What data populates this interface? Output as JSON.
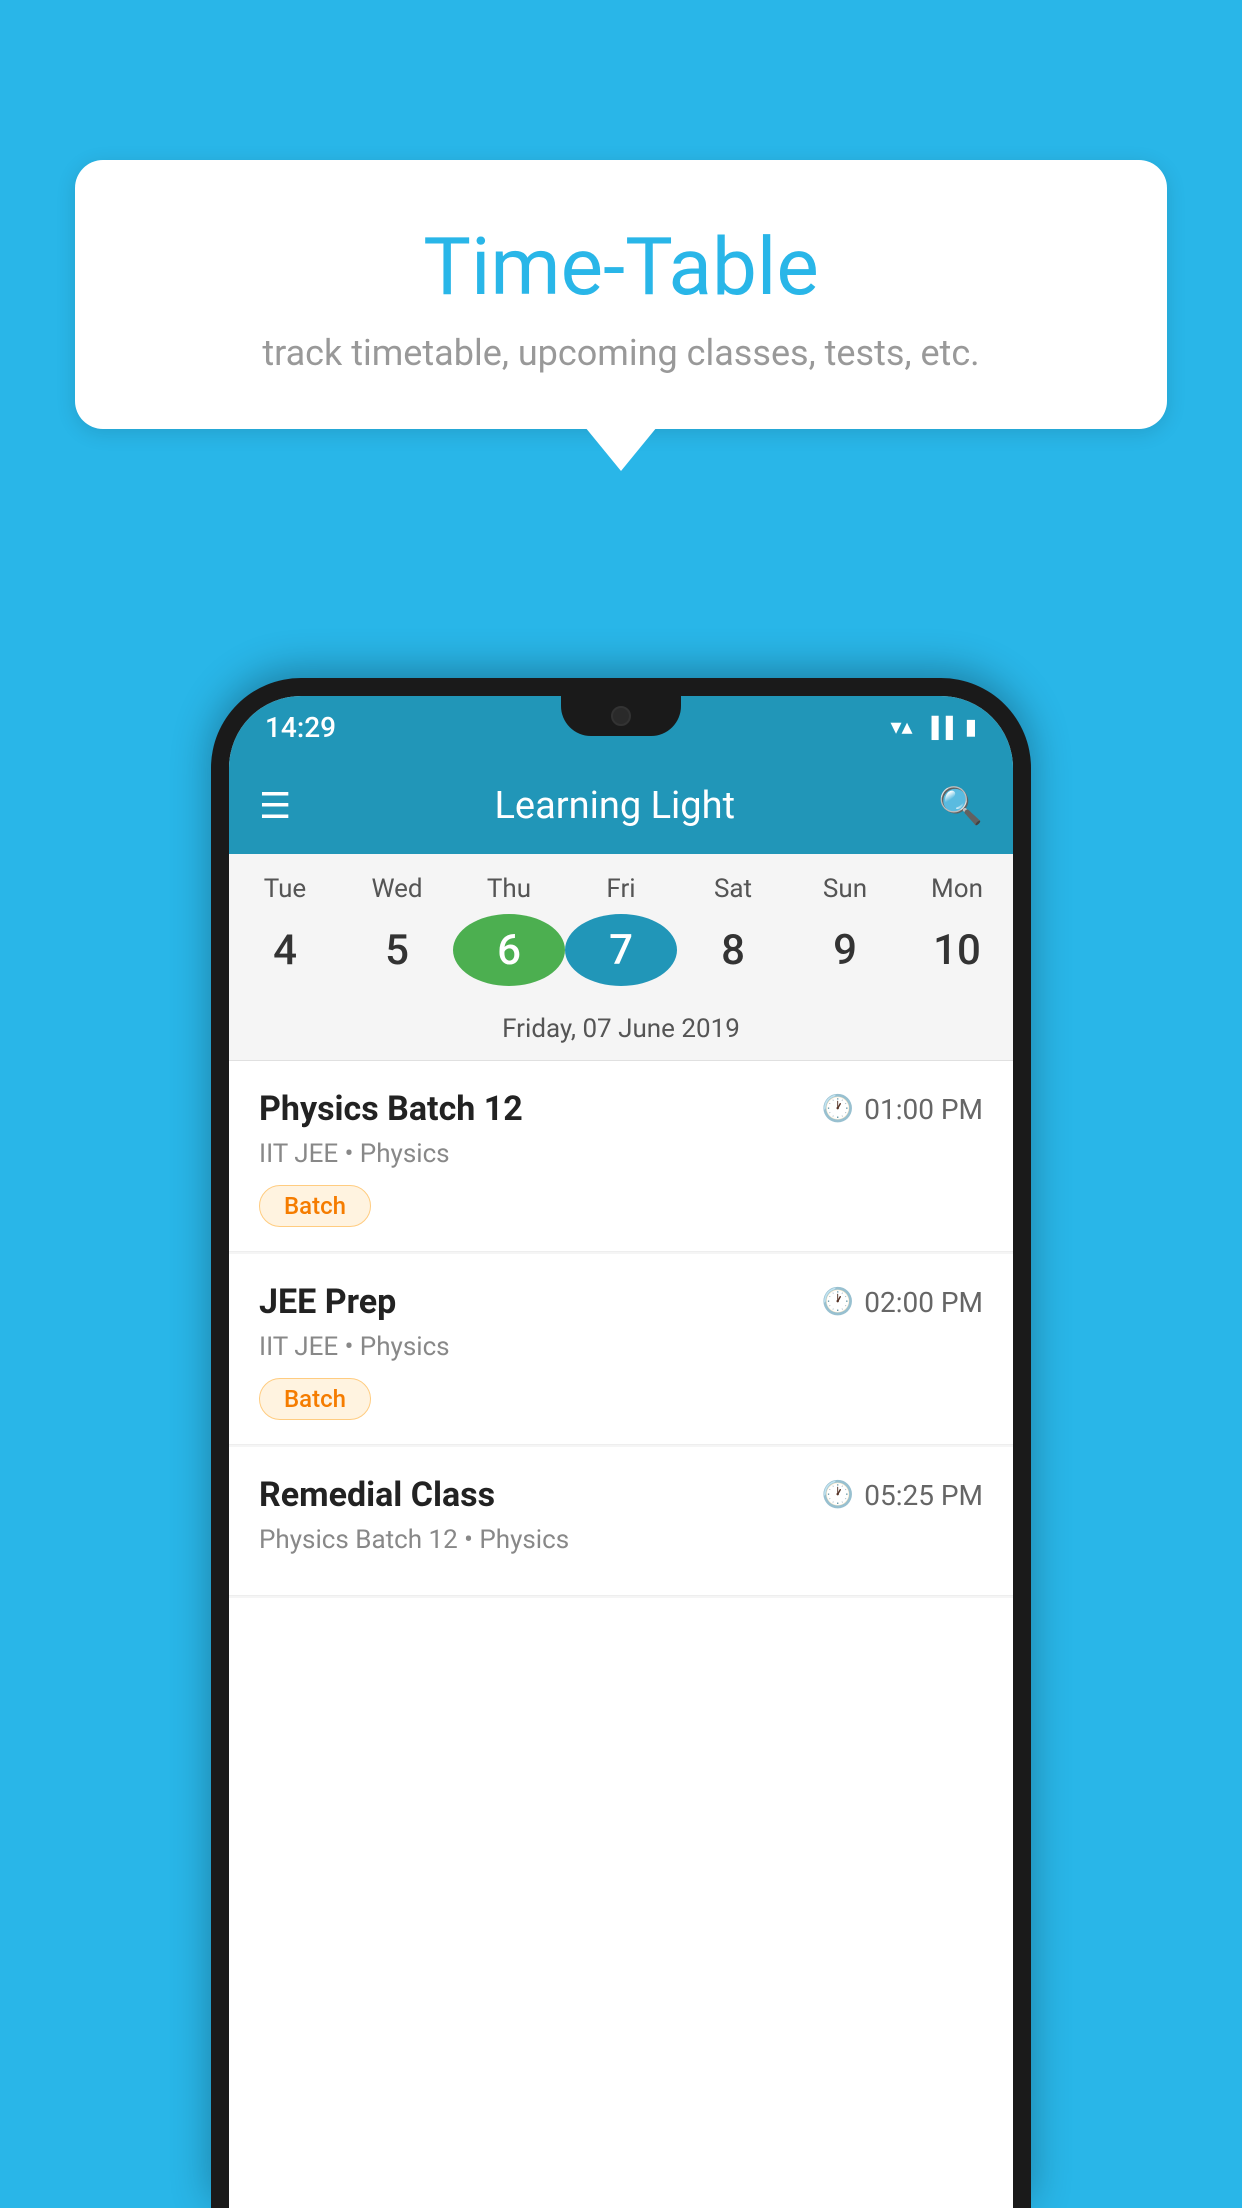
{
  "bubble": {
    "title": "Time-Table",
    "subtitle": "track timetable, upcoming classes, tests, etc."
  },
  "status_bar": {
    "time": "14:29"
  },
  "app_bar": {
    "title": "Learning Light"
  },
  "calendar": {
    "days": [
      {
        "label": "Tue",
        "number": "4"
      },
      {
        "label": "Wed",
        "number": "5"
      },
      {
        "label": "Thu",
        "number": "6",
        "state": "today"
      },
      {
        "label": "Fri",
        "number": "7",
        "state": "selected"
      },
      {
        "label": "Sat",
        "number": "8"
      },
      {
        "label": "Sun",
        "number": "9"
      },
      {
        "label": "Mon",
        "number": "10"
      }
    ],
    "selected_date": "Friday, 07 June 2019"
  },
  "schedule": [
    {
      "title": "Physics Batch 12",
      "time": "01:00 PM",
      "subtitle": "IIT JEE • Physics",
      "badge": "Batch"
    },
    {
      "title": "JEE Prep",
      "time": "02:00 PM",
      "subtitle": "IIT JEE • Physics",
      "badge": "Batch"
    },
    {
      "title": "Remedial Class",
      "time": "05:25 PM",
      "subtitle": "Physics Batch 12 • Physics",
      "badge": null
    }
  ]
}
